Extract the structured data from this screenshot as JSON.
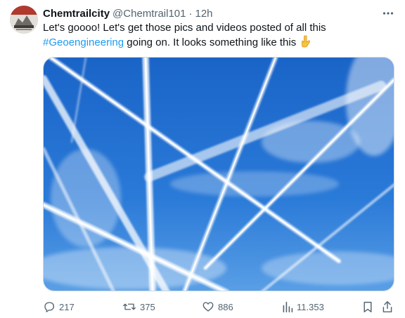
{
  "tweet": {
    "author": {
      "display_name": "Chemtrailcity",
      "handle": "@Chemtrail101",
      "separator": "·",
      "time": "12h"
    },
    "text": {
      "line1": "Let's goooo! Let's get those pics and videos posted of all this",
      "hashtag": "#Geoengineering",
      "line2": " going on. It looks something like this",
      "emoji": "point-down-emoji"
    },
    "media": {
      "kind": "photo",
      "subject": "blue sky with crossing contrails"
    },
    "actions": {
      "replies": "217",
      "reposts": "375",
      "likes": "886",
      "views": "11.353"
    }
  },
  "colors": {
    "text": "#0f1419",
    "secondary": "#536471",
    "link": "#1d9bf0",
    "sky": "#1e6fd0",
    "border": "#cfd9de"
  },
  "icons": [
    "more-icon",
    "reply-icon",
    "repost-icon",
    "like-icon",
    "views-icon",
    "bookmark-icon",
    "share-icon"
  ]
}
